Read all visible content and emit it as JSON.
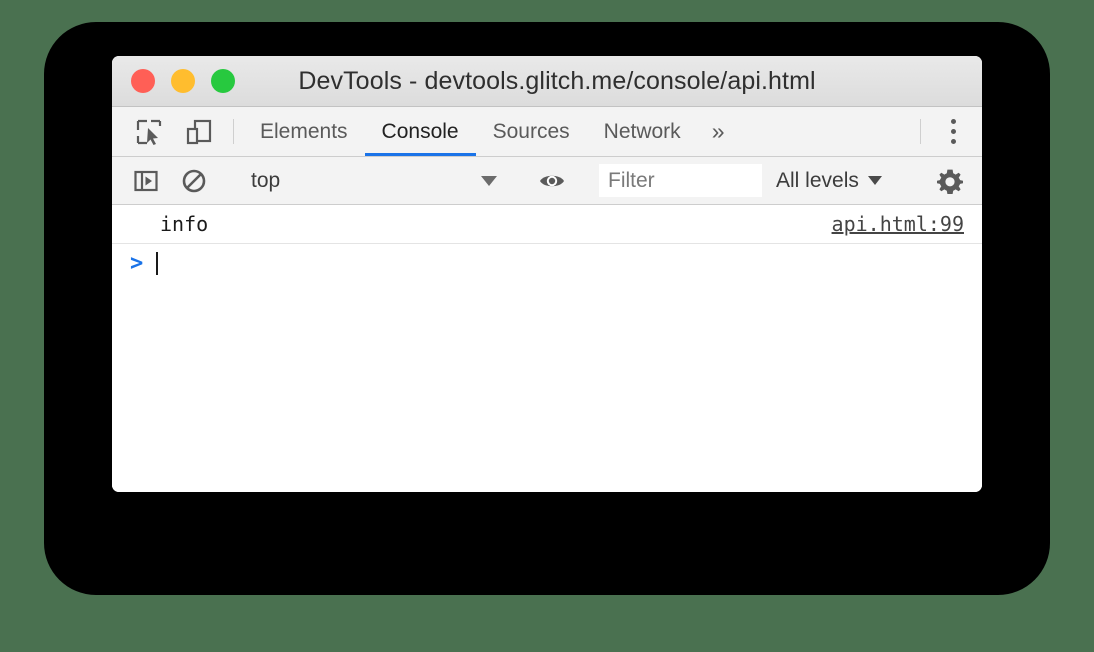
{
  "window": {
    "title": "DevTools - devtools.glitch.me/console/api.html",
    "traffic_lights": [
      {
        "name": "close",
        "color": "#ff5f56"
      },
      {
        "name": "minimize",
        "color": "#ffbd2e"
      },
      {
        "name": "maximize",
        "color": "#27c93f"
      }
    ]
  },
  "tabbar": {
    "inspect_icon": "inspect-element-icon",
    "device_icon": "device-toolbar-icon",
    "tabs": [
      {
        "label": "Elements",
        "active": false
      },
      {
        "label": "Console",
        "active": true
      },
      {
        "label": "Sources",
        "active": false
      },
      {
        "label": "Network",
        "active": false
      }
    ],
    "overflow_label": "»",
    "menu_icon": "more-vertical-icon",
    "active_underline_color": "#1a73e8"
  },
  "console_toolbar": {
    "sidebar_toggle_icon": "console-sidebar-icon",
    "clear_icon": "clear-console-icon",
    "context": {
      "value": "top",
      "caret_icon": "chevron-down-icon"
    },
    "eye_icon": "live-expression-eye-icon",
    "filter": {
      "value": "",
      "placeholder": "Filter"
    },
    "levels": {
      "label": "All levels",
      "caret_icon": "chevron-down-icon"
    },
    "settings_icon": "gear-icon"
  },
  "console": {
    "messages": [
      {
        "text": "info",
        "source": "api.html:99"
      }
    ],
    "prompt": {
      "arrow": ">",
      "input_value": ""
    }
  }
}
